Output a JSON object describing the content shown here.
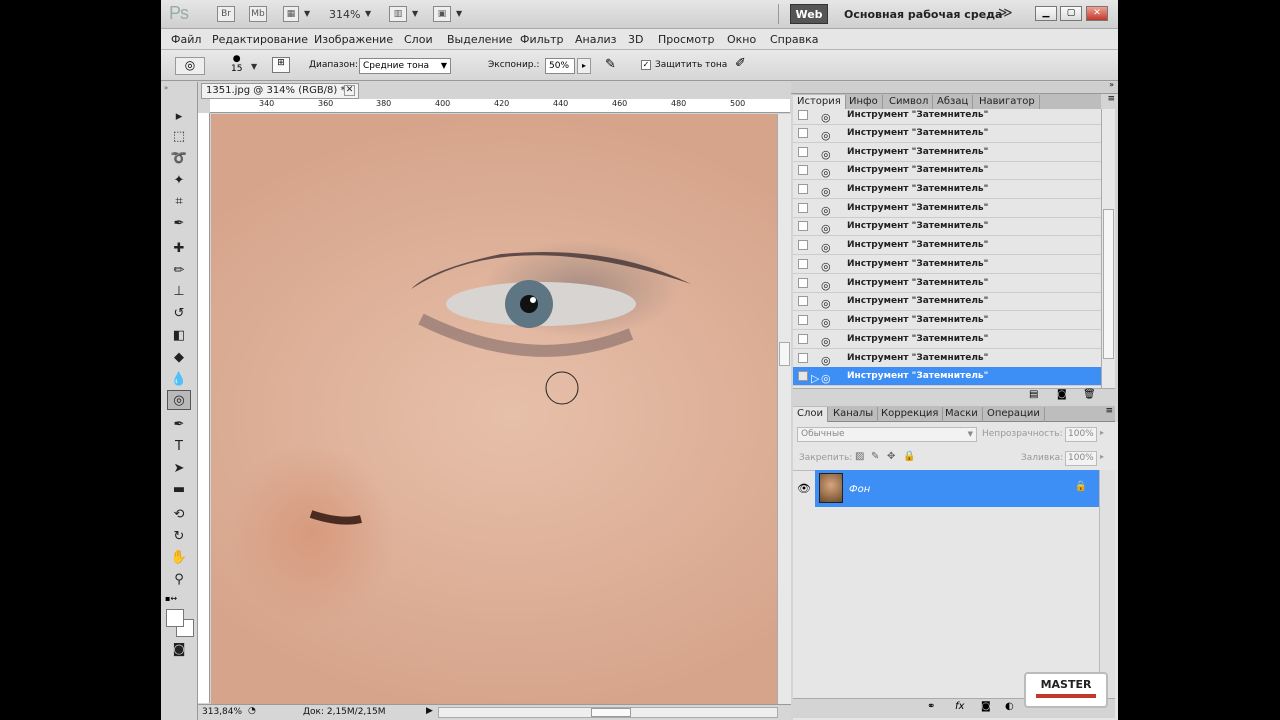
{
  "titlebar": {
    "logo": "Ps",
    "br_btn": "Br",
    "mb_btn": "Mb",
    "zoom": "314%",
    "web_btn": "Web",
    "workspace": "Основная рабочая среда",
    "workspace_more": "≫"
  },
  "menu": [
    "Файл",
    "Редактирование",
    "Изображение",
    "Слои",
    "Выделение",
    "Фильтр",
    "Анализ",
    "3D",
    "Просмотр",
    "Окно",
    "Справка"
  ],
  "options": {
    "brush_size": "15",
    "range_label": "Диапазон:",
    "range_value": "Средние тона",
    "exposure_label": "Экспонир.:",
    "exposure_value": "50%",
    "protect_label": "Защитить тона"
  },
  "document": {
    "tab_title": "1351.jpg @ 314% (RGB/8) *",
    "ruler_h": [
      "340",
      "360",
      "380",
      "400",
      "420",
      "440",
      "460",
      "480",
      "500"
    ],
    "zoom_status": "313,84%",
    "doc_status": "Док: 2,15M/2,15M"
  },
  "history_panel": {
    "tabs": [
      "История",
      "Инфо",
      "Символ",
      "Абзац",
      "Навигатор"
    ],
    "items": [
      "Инструмент \"Затемнитель\"",
      "Инструмент \"Затемнитель\"",
      "Инструмент \"Затемнитель\"",
      "Инструмент \"Затемнитель\"",
      "Инструмент \"Затемнитель\"",
      "Инструмент \"Затемнитель\"",
      "Инструмент \"Затемнитель\"",
      "Инструмент \"Затемнитель\"",
      "Инструмент \"Затемнитель\"",
      "Инструмент \"Затемнитель\"",
      "Инструмент \"Затемнитель\"",
      "Инструмент \"Затемнитель\"",
      "Инструмент \"Затемнитель\"",
      "Инструмент \"Затемнитель\"",
      "Инструмент \"Затемнитель\""
    ]
  },
  "layers_panel": {
    "tabs": [
      "Слои",
      "Каналы",
      "Коррекция",
      "Маски",
      "Операции"
    ],
    "blend_mode": "Обычные",
    "opacity_label": "Непрозрачность:",
    "opacity_value": "100%",
    "lock_label": "Закрепить:",
    "fill_label": "Заливка:",
    "fill_value": "100%",
    "layer_name": "Фон"
  },
  "watermark": "MASTER",
  "colors": {
    "selection": "#3d8ff5",
    "ui_bg": "#d4d4d4"
  }
}
